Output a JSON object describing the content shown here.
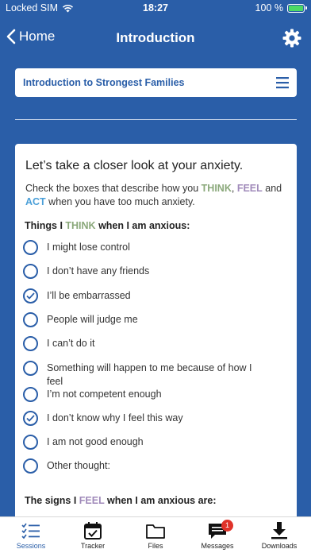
{
  "status_bar": {
    "carrier": "Locked SIM",
    "time": "18:27",
    "battery": "100 %"
  },
  "nav": {
    "back_label": "Home",
    "title": "Introduction"
  },
  "module": {
    "title": "Introduction to Strongest Families"
  },
  "content": {
    "heading": "Let’s take a closer look at your anxiety.",
    "instructions": {
      "part1": "Check the boxes that describe how you ",
      "think": "THINK",
      "comma": ", ",
      "feel": "FEEL",
      "part2": " and ",
      "act": "ACT",
      "part3": " when you have too much anxiety."
    },
    "think_section": {
      "prefix": "Things I ",
      "keyword": "THINK",
      "suffix": " when I am anxious:"
    },
    "items": [
      {
        "label": "I might lose control",
        "checked": false
      },
      {
        "label": "I don’t have any friends",
        "checked": false
      },
      {
        "label": "I’ll be embarrassed",
        "checked": true
      },
      {
        "label": "People will judge me",
        "checked": false
      },
      {
        "label": "I can’t do it",
        "checked": false
      },
      {
        "label": "Something will happen to me because of how I feel",
        "checked": false
      },
      {
        "label": "I’m not competent enough",
        "checked": false
      },
      {
        "label": "I don’t know why I feel this way",
        "checked": true
      },
      {
        "label": "I am not good enough",
        "checked": false
      },
      {
        "label": "Other thought:",
        "checked": false
      }
    ],
    "feel_section": {
      "prefix": "The signs I ",
      "keyword": "FEEL",
      "suffix": " when I am anxious are:"
    }
  },
  "tabs": [
    {
      "label": "Sessions",
      "icon": "sessions-list-icon",
      "active": true
    },
    {
      "label": "Tracker",
      "icon": "calendar-check-icon",
      "active": false
    },
    {
      "label": "Files",
      "icon": "folder-icon",
      "active": false
    },
    {
      "label": "Messages",
      "icon": "message-icon",
      "active": false,
      "badge": "1"
    },
    {
      "label": "Downloads",
      "icon": "download-icon",
      "active": false
    }
  ],
  "colors": {
    "brand_blue": "#2a5ea8",
    "think": "#8aa87a",
    "feel": "#a08aba",
    "act": "#4a9fd8",
    "badge": "#e0332a",
    "battery": "#4cd964"
  }
}
